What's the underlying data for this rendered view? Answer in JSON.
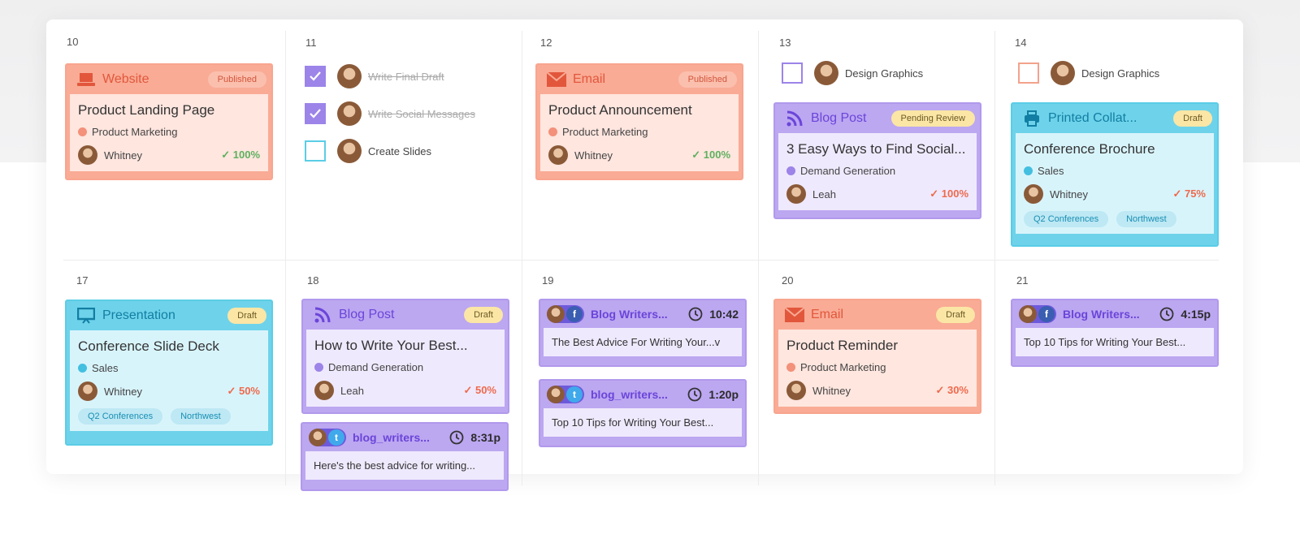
{
  "days": [
    "10",
    "11",
    "12",
    "13",
    "14",
    "17",
    "18",
    "19",
    "20",
    "21"
  ],
  "cards": {
    "website": {
      "type": "Website",
      "badge": "Published",
      "name": "Product Landing Page",
      "category": "Product Marketing",
      "user": "Whitney",
      "progress": "100%"
    },
    "email12": {
      "type": "Email",
      "badge": "Published",
      "name": "Product Announcement",
      "category": "Product Marketing",
      "user": "Whitney",
      "progress": "100%"
    },
    "blog13": {
      "type": "Blog Post",
      "badge": "Pending Review",
      "name": "3 Easy Ways to Find Social...",
      "category": "Demand Generation",
      "user": "Leah",
      "progress": "100%"
    },
    "printed14": {
      "type": "Printed Collat...",
      "badge": "Draft",
      "name": "Conference Brochure",
      "category": "Sales",
      "user": "Whitney",
      "progress": "75%",
      "tags": [
        "Q2 Conferences",
        "Northwest"
      ]
    },
    "pres17": {
      "type": "Presentation",
      "badge": "Draft",
      "name": "Conference Slide Deck",
      "category": "Sales",
      "user": "Whitney",
      "progress": "50%",
      "tags": [
        "Q2 Conferences",
        "Northwest"
      ]
    },
    "blog18": {
      "type": "Blog Post",
      "badge": "Draft",
      "name": "How to Write Your Best...",
      "category": "Demand Generation",
      "user": "Leah",
      "progress": "50%"
    },
    "email20": {
      "type": "Email",
      "badge": "Draft",
      "name": "Product Reminder",
      "category": "Product Marketing",
      "user": "Whitney",
      "progress": "30%"
    }
  },
  "tasks11": [
    {
      "label": "Write Final Draft",
      "done": true
    },
    {
      "label": "Write Social Messages",
      "done": true
    },
    {
      "label": "Create Slides",
      "done": false
    }
  ],
  "tasks13": {
    "label": "Design Graphics"
  },
  "tasks14": {
    "label": "Design Graphics"
  },
  "social": {
    "s18": {
      "handle": "blog_writers...",
      "network": "twitter",
      "time": "8:31p",
      "text": "Here's the best advice for writing..."
    },
    "s19a": {
      "handle": "Blog Writers...",
      "network": "facebook",
      "time": "10:42",
      "text": "The Best Advice For Writing Your...v"
    },
    "s19b": {
      "handle": "blog_writers...",
      "network": "twitter",
      "time": "1:20p",
      "text": "Top 10 Tips for Writing Your Best..."
    },
    "s21": {
      "handle": "Blog Writers...",
      "network": "facebook",
      "time": "4:15p",
      "text": "Top 10 Tips for Writing Your Best..."
    }
  },
  "colors": {
    "orange": "#f9ab95",
    "purple": "#bca7f1",
    "blue": "#6ed3ea",
    "green_check": "#5fb05f",
    "red_check": "#ee6a4d"
  }
}
